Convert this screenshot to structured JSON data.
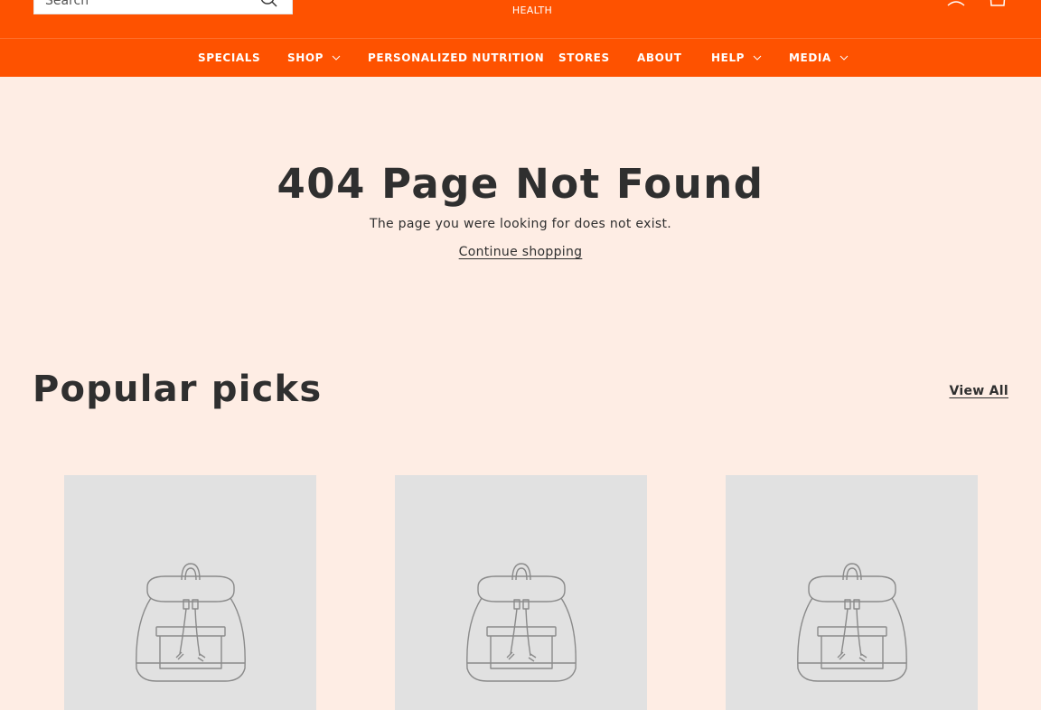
{
  "header": {
    "search": {
      "placeholder": "Search"
    },
    "logo": {
      "subtext": "HEALTH"
    },
    "icons": {
      "search": "search-icon",
      "account": "account-icon",
      "cart": "cart-icon"
    },
    "background_color": "#fe5200"
  },
  "nav": {
    "items": [
      {
        "label": "SPECIALS",
        "has_dropdown": false
      },
      {
        "label": "SHOP",
        "has_dropdown": true
      },
      {
        "label": "PERSONALIZED NUTRITION",
        "has_dropdown": false
      },
      {
        "label": "STORES",
        "has_dropdown": false
      },
      {
        "label": "ABOUT",
        "has_dropdown": false
      },
      {
        "label": "HELP",
        "has_dropdown": true
      },
      {
        "label": "MEDIA",
        "has_dropdown": true
      }
    ]
  },
  "not_found": {
    "title": "404 Page Not Found",
    "message": "The page you were looking for does not exist.",
    "link_label": "Continue shopping"
  },
  "popular": {
    "title": "Popular picks",
    "view_all_label": "View All",
    "products": [
      {
        "image": "backpack-placeholder-icon"
      },
      {
        "image": "backpack-placeholder-icon"
      },
      {
        "image": "backpack-placeholder-icon"
      }
    ]
  },
  "colors": {
    "accent": "#fe5200",
    "page_background": "#feede4",
    "text": "#2f2f2f",
    "placeholder_tile": "#e1e1e1"
  }
}
